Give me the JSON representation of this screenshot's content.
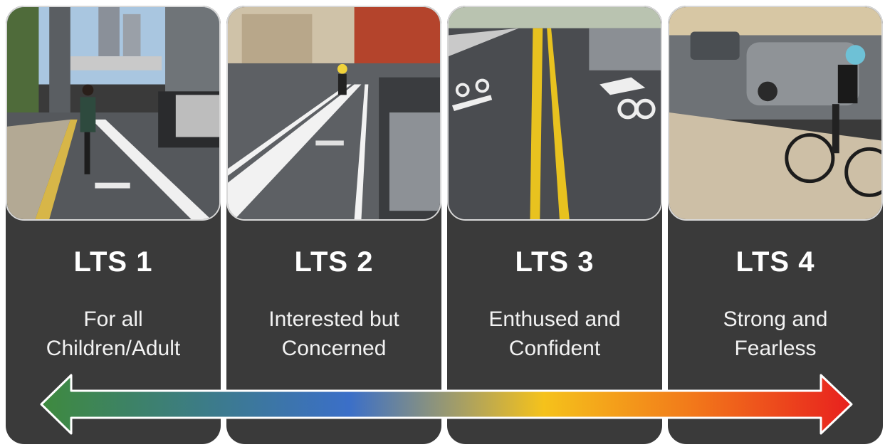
{
  "levels": [
    {
      "label": "LTS 1",
      "desc_line1": "For all",
      "desc_line2": "Children/Adult"
    },
    {
      "label": "LTS 2",
      "desc_line1": "Interested but",
      "desc_line2": "Concerned"
    },
    {
      "label": "LTS 3",
      "desc_line1": "Enthused and",
      "desc_line2": "Confident"
    },
    {
      "label": "LTS 4",
      "desc_line1": "Strong and",
      "desc_line2": "Fearless"
    }
  ],
  "photos": [
    {
      "subject": "protected bike lane with cyclist"
    },
    {
      "subject": "painted buffered bike lane beside traffic"
    },
    {
      "subject": "shared lane marking (sharrow) on street"
    },
    {
      "subject": "cyclist riding in mixed traffic"
    }
  ],
  "arrow": {
    "direction": "bidirectional",
    "gradient_colors": [
      "#3e8a3e",
      "#3b6fc8",
      "#f5c21b",
      "#f27a1a",
      "#e8201e"
    ]
  }
}
